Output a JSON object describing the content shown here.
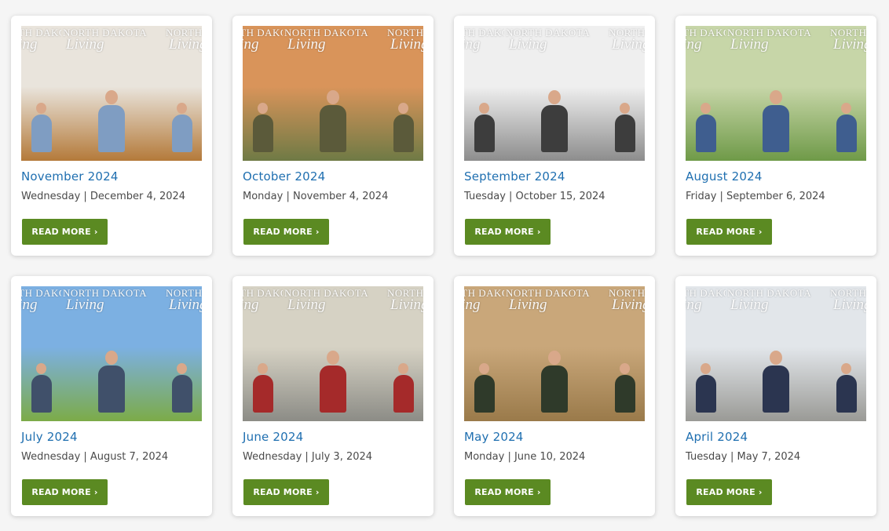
{
  "masthead": {
    "line1": "NORTH DAKOTA",
    "line2": "Living"
  },
  "button_label": "READ MORE ›",
  "issues": [
    {
      "title": "November 2024",
      "date": "Wednesday | December 4, 2024",
      "cover_bg": "#b47a3a",
      "cover_sky": "#e9e4dc",
      "figure_color": "#7f9dc2"
    },
    {
      "title": "October 2024",
      "date": "Monday | November 4, 2024",
      "cover_bg": "#6f7a45",
      "cover_sky": "#d9945a",
      "figure_color": "#5b5a3a"
    },
    {
      "title": "September 2024",
      "date": "Tuesday | October 15, 2024",
      "cover_bg": "#8d8d8d",
      "cover_sky": "#efefef",
      "figure_color": "#3d3d3d"
    },
    {
      "title": "August 2024",
      "date": "Friday | September 6, 2024",
      "cover_bg": "#6f9a48",
      "cover_sky": "#c7d6a8",
      "figure_color": "#3f5e8f"
    },
    {
      "title": "July 2024",
      "date": "Wednesday | August 7, 2024",
      "cover_bg": "#7cab48",
      "cover_sky": "#7cb0e2",
      "figure_color": "#40506a"
    },
    {
      "title": "June 2024",
      "date": "Wednesday | July 3, 2024",
      "cover_bg": "#8c8c86",
      "cover_sky": "#d6d2c4",
      "figure_color": "#a52a2a"
    },
    {
      "title": "May 2024",
      "date": "Monday | June 10, 2024",
      "cover_bg": "#9a7a4a",
      "cover_sky": "#c9a77a",
      "figure_color": "#2f3a2a"
    },
    {
      "title": "April 2024",
      "date": "Tuesday | May 7, 2024",
      "cover_bg": "#9a9a96",
      "cover_sky": "#e2e6ea",
      "figure_color": "#2b3550"
    }
  ]
}
